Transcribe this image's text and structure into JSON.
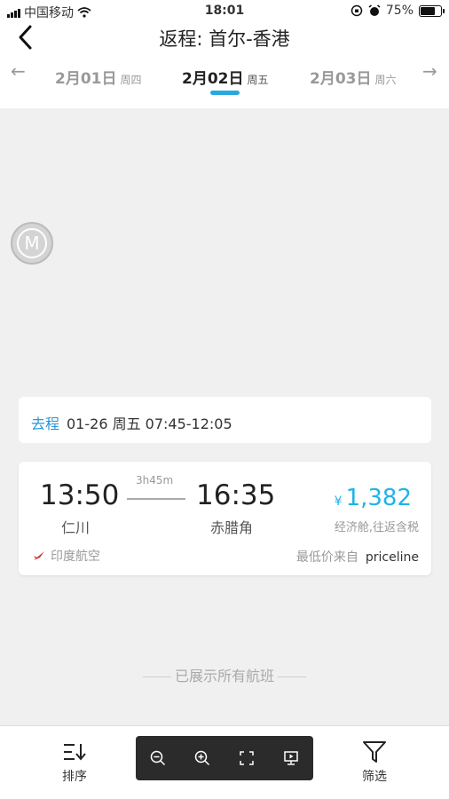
{
  "status_bar": {
    "carrier": "中国移动",
    "time": "18:01",
    "battery": "75%"
  },
  "nav": {
    "title": "返程: 首尔-香港"
  },
  "date_bar": {
    "dates": [
      {
        "date": "2月01日",
        "weekday": "周四"
      },
      {
        "date": "2月02日",
        "weekday": "周五"
      },
      {
        "date": "2月03日",
        "weekday": "周六"
      }
    ],
    "selected": 1,
    "accent_color": "#29a8e0"
  },
  "outbound": {
    "label": "去程",
    "info": "01-26 周五  07:45-12:05"
  },
  "flight": {
    "dep_time": "13:50",
    "dep_airport": "仁川",
    "duration": "3h45m",
    "arr_time": "16:35",
    "arr_airport": "赤腊角",
    "currency": "¥",
    "price": "1,382",
    "cabin": "经济舱,往返含税",
    "airline": "印度航空",
    "source_label": "最低价来自",
    "source_name": "priceline",
    "price_color": "#1fb4e6"
  },
  "end_note": "已展示所有航班",
  "bottom_bar": {
    "sort_label": "排序",
    "filter_label": "筛选"
  },
  "icons": {
    "back": "chevron-left-icon",
    "sort": "sort-icon",
    "filter": "funnel-icon",
    "zoom_out": "zoom-out-icon",
    "zoom_in": "zoom-in-icon",
    "fullscreen": "fullscreen-icon",
    "present": "present-icon"
  }
}
